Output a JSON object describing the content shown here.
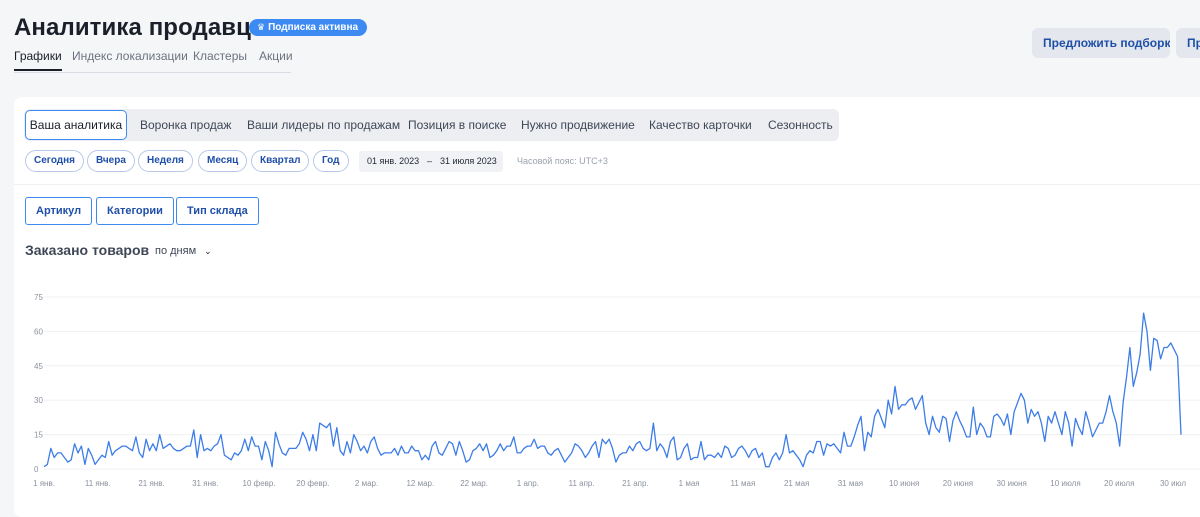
{
  "header": {
    "title": "Аналитика продавца",
    "badge": "Подписка активна",
    "badge_icon": "crown-icon",
    "tabs": [
      {
        "label": "Графики",
        "active": true
      },
      {
        "label": "Индекс локализации",
        "active": false
      },
      {
        "label": "Кластеры",
        "active": false
      },
      {
        "label": "Акции",
        "active": false
      }
    ],
    "buttons": [
      "Предложить подборку",
      "Пр"
    ]
  },
  "analytics_tabs": [
    {
      "label": "Ваша аналитика",
      "active": true
    },
    {
      "label": "Воронка продаж",
      "active": false
    },
    {
      "label": "Ваши лидеры по продажам",
      "active": false
    },
    {
      "label": "Позиция в поиске",
      "active": false
    },
    {
      "label": "Нужно продвижение",
      "active": false
    },
    {
      "label": "Качество карточки",
      "active": false
    },
    {
      "label": "Сезонность",
      "active": false
    }
  ],
  "periods": [
    "Сегодня",
    "Вчера",
    "Неделя",
    "Месяц",
    "Квартал",
    "Год"
  ],
  "date_range": {
    "from": "01 янв. 2023",
    "separator": "–",
    "to": "31 июля 2023"
  },
  "timezone": "Часовой пояс: UTC+3",
  "filters": [
    "Артикул",
    "Категории",
    "Тип склада"
  ],
  "chart_header": {
    "title": "Заказано товаров",
    "granularity": "по дням"
  },
  "colors": {
    "accent": "#3d8bf2",
    "line": "#3d7de8",
    "grid": "#eef0f3"
  },
  "chart_data": {
    "type": "line",
    "title": "Заказано товаров",
    "xlabel": "",
    "ylabel": "",
    "ylim": [
      0,
      75
    ],
    "y_ticks": [
      0,
      15,
      30,
      45,
      60,
      75
    ],
    "x_ticks": [
      "1 янв.",
      "11 янв.",
      "21 янв.",
      "31 янв.",
      "10 февр.",
      "20 февр.",
      "2 мар.",
      "12 мар.",
      "22 мар.",
      "1 апр.",
      "11 апр.",
      "21 апр.",
      "1 мая",
      "11 мая",
      "21 мая",
      "31 мая",
      "10 июня",
      "20 июня",
      "30 июня",
      "10 июля",
      "20 июля",
      "30 июл"
    ],
    "grid": true,
    "legend": "none",
    "series": [
      {
        "values": [
          1,
          2,
          9,
          5,
          7,
          7,
          5,
          3,
          4,
          11,
          7,
          10,
          2,
          9,
          6,
          2,
          4,
          6,
          5,
          12,
          6,
          8,
          9,
          10,
          10,
          9,
          8,
          14,
          7,
          5,
          13,
          8,
          11,
          8,
          15,
          9,
          10,
          11,
          9,
          8,
          8,
          9,
          10,
          10,
          17,
          5,
          15,
          8,
          9,
          8,
          10,
          11,
          15,
          6,
          5,
          4,
          7,
          6,
          8,
          13,
          8,
          14,
          10,
          10,
          4,
          12,
          8,
          1,
          16,
          11,
          7,
          6,
          9,
          9,
          9,
          11,
          16,
          13,
          8,
          15,
          8,
          20,
          19,
          18,
          20,
          10,
          18,
          8,
          6,
          12,
          7,
          15,
          12,
          8,
          10,
          7,
          12,
          14,
          9,
          6,
          7,
          7,
          7,
          9,
          6,
          10,
          7,
          7,
          10,
          8,
          8,
          4,
          6,
          4,
          10,
          12,
          7,
          6,
          9,
          12,
          11,
          6,
          12,
          8,
          3,
          4,
          8,
          9,
          11,
          8,
          11,
          5,
          6,
          8,
          11,
          8,
          10,
          10,
          14,
          7,
          7,
          9,
          10,
          10,
          13,
          9,
          10,
          10,
          7,
          6,
          8,
          9,
          6,
          3,
          5,
          7,
          11,
          10,
          8,
          5,
          7,
          10,
          12,
          5,
          13,
          11,
          13,
          9,
          3,
          6,
          7,
          7,
          10,
          8,
          11,
          12,
          9,
          8,
          9,
          20,
          8,
          11,
          9,
          5,
          12,
          14,
          4,
          5,
          9,
          11,
          4,
          5,
          5,
          12,
          4,
          6,
          6,
          5,
          7,
          5,
          10,
          9,
          5,
          6,
          9,
          10,
          8,
          5,
          8,
          9,
          5,
          7,
          1,
          1,
          5,
          7,
          4,
          7,
          15,
          7,
          8,
          6,
          4,
          1,
          6,
          8,
          7,
          12,
          12,
          6,
          11,
          10,
          11,
          9,
          7,
          16,
          10,
          10,
          14,
          19,
          23,
          8,
          16,
          14,
          23,
          26,
          22,
          18,
          30,
          24,
          36,
          26,
          28,
          28,
          30,
          31,
          26,
          29,
          32,
          20,
          15,
          23,
          18,
          16,
          23,
          22,
          12,
          21,
          25,
          21,
          18,
          14,
          14,
          27,
          15,
          20,
          18,
          14,
          14,
          23,
          24,
          22,
          19,
          24,
          15,
          25,
          29,
          33,
          30,
          20,
          26,
          23,
          25,
          20,
          12,
          23,
          20,
          25,
          20,
          15,
          25,
          20,
          10,
          22,
          18,
          15,
          25,
          20,
          14,
          17,
          20,
          20,
          25,
          32,
          25,
          20,
          10,
          29,
          40,
          53,
          36,
          42,
          50,
          68,
          60,
          43,
          57,
          56,
          48,
          53,
          53,
          55,
          52,
          49,
          15
        ]
      }
    ]
  }
}
